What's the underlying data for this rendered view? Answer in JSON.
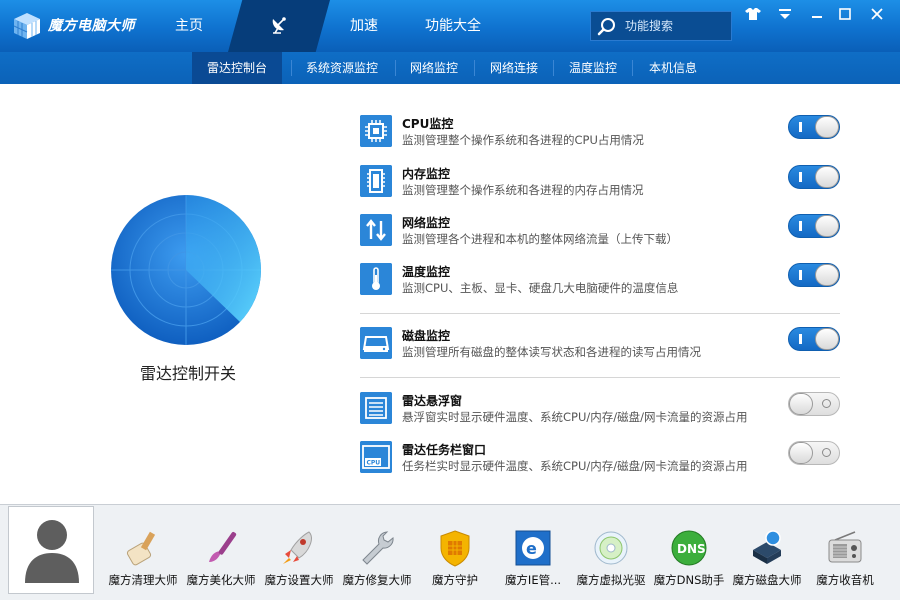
{
  "app": {
    "title": "魔方电脑大师"
  },
  "nav": {
    "home": "主页",
    "speed": "加速",
    "all": "功能大全"
  },
  "search": {
    "placeholder": "功能搜索"
  },
  "subnav": [
    "雷达控制台",
    "系统资源监控",
    "网络监控",
    "网络连接",
    "温度监控",
    "本机信息"
  ],
  "radar": {
    "label": "雷达控制开关"
  },
  "features": [
    {
      "title": "CPU监控",
      "desc": "监测管理整个操作系统和各进程的CPU占用情况",
      "on": true,
      "icon": "cpu-icon"
    },
    {
      "title": "内存监控",
      "desc": "监测管理整个操作系统和各进程的内存占用情况",
      "on": true,
      "icon": "memory-icon"
    },
    {
      "title": "网络监控",
      "desc": "监测管理各个进程和本机的整体网络流量（上传下载）",
      "on": true,
      "icon": "network-icon"
    },
    {
      "title": "温度监控",
      "desc": "监测CPU、主板、显卡、硬盘几大电脑硬件的温度信息",
      "on": true,
      "icon": "thermometer-icon"
    },
    {
      "title": "磁盘监控",
      "desc": "监测管理所有磁盘的整体读写状态和各进程的读写占用情况",
      "on": true,
      "icon": "disk-icon"
    },
    {
      "title": "雷达悬浮窗",
      "desc": "悬浮窗实时显示硬件温度、系统CPU/内存/磁盘/网卡流量的资源占用",
      "on": false,
      "icon": "float-window-icon"
    },
    {
      "title": "雷达任务栏窗口",
      "desc": "任务栏实时显示硬件温度、系统CPU/内存/磁盘/网卡流量的资源占用",
      "on": false,
      "icon": "taskbar-window-icon"
    }
  ],
  "tools": [
    "魔方清理大师",
    "魔方美化大师",
    "魔方设置大师",
    "魔方修复大师",
    "魔方守护",
    "魔方IE管...",
    "魔方虚拟光驱",
    "魔方DNS助手",
    "魔方磁盘大师",
    "魔方收音机"
  ],
  "colors": {
    "accent": "#0f72cf",
    "dark": "#063d7a",
    "toggle_on": "#1469c4"
  }
}
